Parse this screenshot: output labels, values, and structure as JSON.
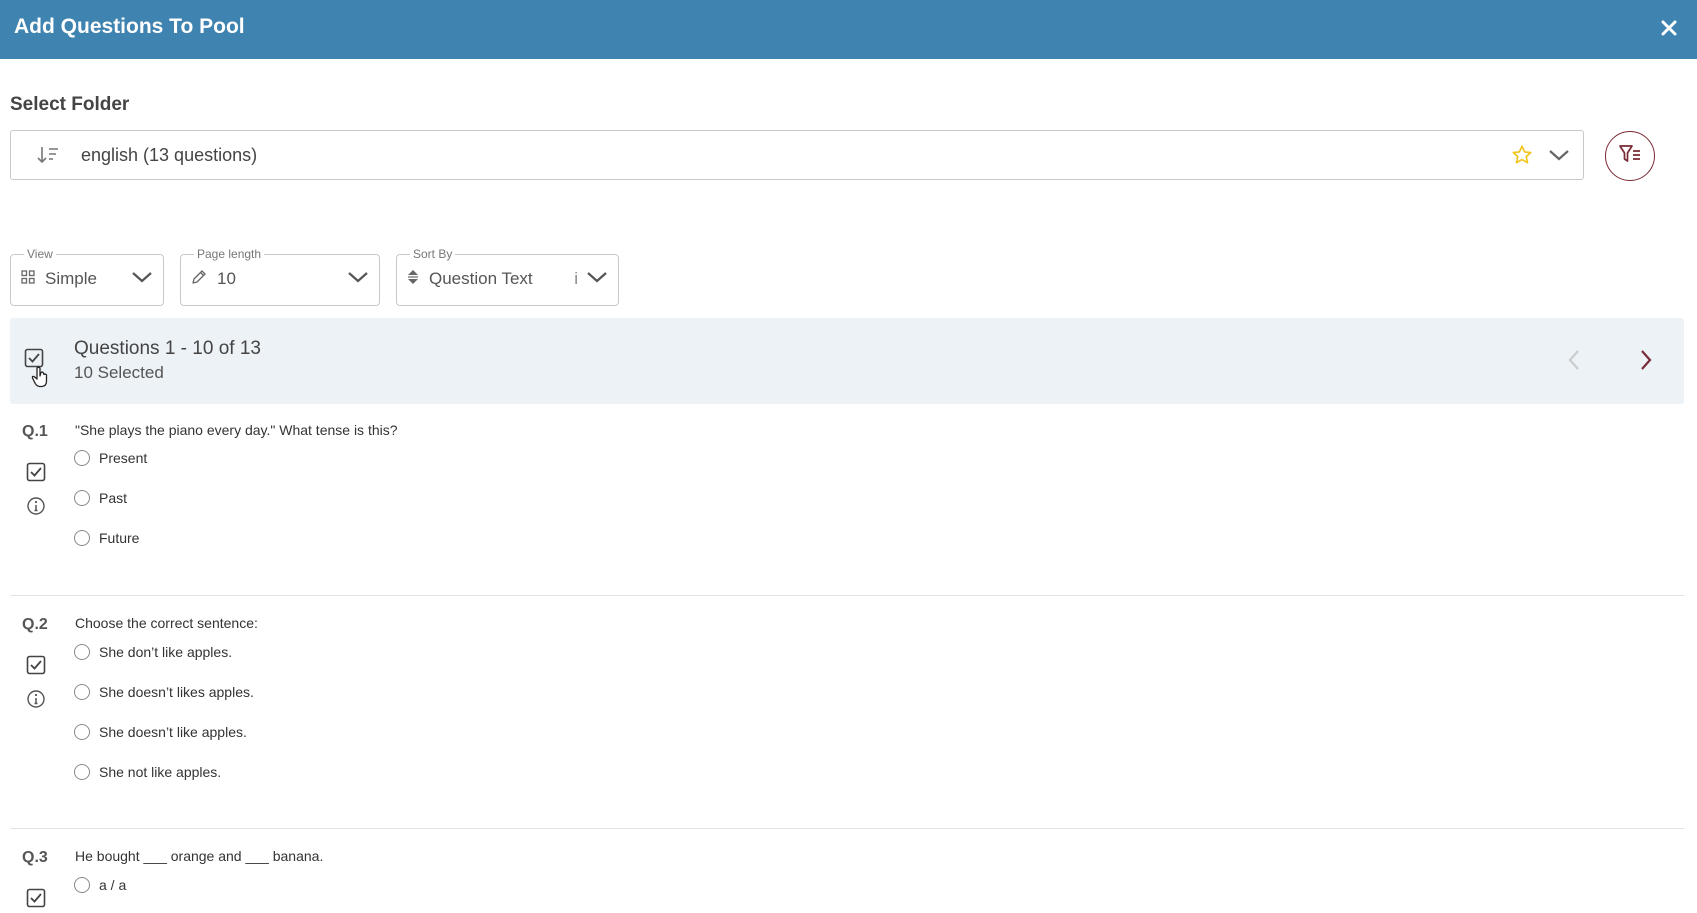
{
  "dialog": {
    "title": "Add Questions To Pool"
  },
  "folder": {
    "label": "Select Folder",
    "selected": "english (13 questions)"
  },
  "controls": {
    "view": {
      "legend": "View",
      "value": "Simple"
    },
    "page_length": {
      "legend": "Page length",
      "value": "10"
    },
    "sort_by": {
      "legend": "Sort By",
      "value": "Question Text",
      "info": "i"
    }
  },
  "summary": {
    "range": "Questions 1 - 10 of 13",
    "selected": "10 Selected"
  },
  "questions": [
    {
      "number": "Q.1",
      "text": "\"She plays the piano every day.\" What tense is this?",
      "options": [
        "Present",
        "Past",
        "Future"
      ]
    },
    {
      "number": "Q.2",
      "text": "Choose the correct sentence:",
      "options": [
        "She don’t like apples.",
        "She doesn’t likes apples.",
        "She doesn’t like apples.",
        "She not like apples."
      ]
    },
    {
      "number": "Q.3",
      "text": "He bought ___ orange and ___ banana.",
      "options": [
        "a / a"
      ]
    }
  ],
  "colors": {
    "header": "#3f83b0",
    "accent": "#7a2a36",
    "summary_bg": "#edf2f7",
    "star": "#f0c419"
  }
}
